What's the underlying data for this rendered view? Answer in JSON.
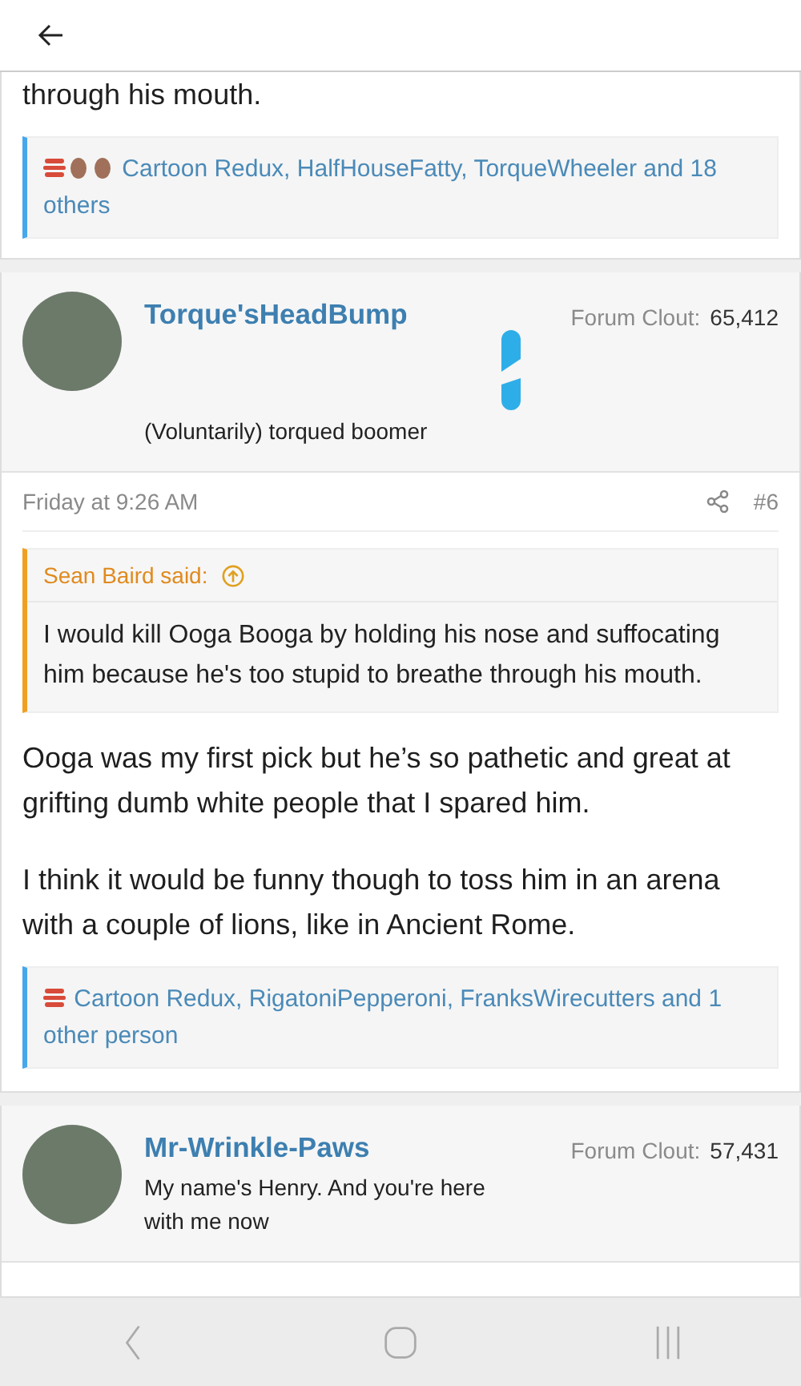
{
  "thread": [
    {
      "kind": "fragment",
      "body": [
        "through his mouth."
      ],
      "reactions": {
        "icons": [
          {
            "kind": "burger"
          },
          {
            "kind": "face"
          },
          {
            "kind": "face"
          }
        ],
        "text": "Cartoon Redux, HalfHouseFatty, TorqueWheeler and 18 others"
      }
    },
    {
      "kind": "post",
      "username": "Torque'sHeadBump",
      "clout_label": "Forum Clout:",
      "clout": "65,412",
      "user_title": "(Voluntarily) torqued boomer",
      "badge": true,
      "date": "Friday at 9:26 AM",
      "number": "#6",
      "quote": {
        "author": "Sean Baird said:",
        "text": "I would kill Ooga Booga by holding his nose and suffocating him because he's too stupid to breathe through his mouth."
      },
      "body": [
        "Ooga was my first pick but he’s so pathetic and great at grifting dumb white people that I spared him.",
        "I think it would be funny though to toss him in an arena with a couple of lions, like in Ancient Rome."
      ],
      "reactions": {
        "icons": [
          {
            "kind": "burger"
          }
        ],
        "text": "Cartoon Redux, RigatoniPepperoni, FranksWirecutters and 1 other person"
      }
    },
    {
      "kind": "header",
      "username": "Mr-Wrinkle-Paws",
      "clout_label": "Forum Clout:",
      "clout": "57,431",
      "user_title": "My name's Henry. And you're here with me now"
    }
  ]
}
